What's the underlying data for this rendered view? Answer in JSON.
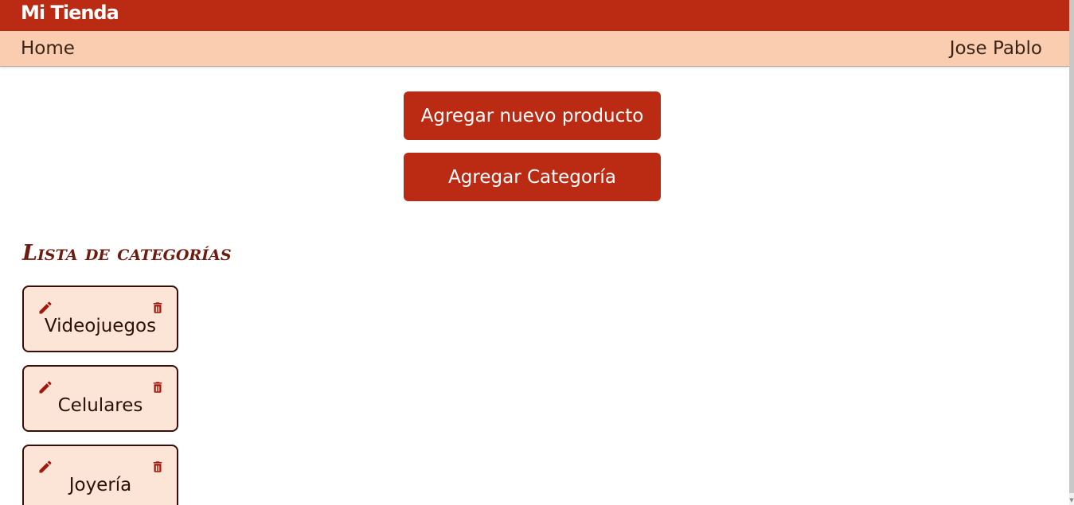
{
  "header": {
    "brand": "Mi Tienda"
  },
  "nav": {
    "home_label": "Home",
    "user_label": "Jose Pablo"
  },
  "actions": {
    "add_product_label": "Agregar nuevo producto",
    "add_category_label": "Agregar Categoría"
  },
  "categories": {
    "title": "Lista de categorías",
    "items": [
      {
        "label": "Videojuegos",
        "edit_icon": "pencil-icon",
        "delete_icon": "trash-icon"
      },
      {
        "label": "Celulares",
        "edit_icon": "pencil-icon",
        "delete_icon": "trash-icon"
      },
      {
        "label": "Joyería",
        "edit_icon": "pencil-icon",
        "delete_icon": "trash-icon"
      }
    ]
  },
  "colors": {
    "primary": "#bb2a13",
    "nav_background": "#fbcdb0",
    "card_background": "#fce5d6",
    "card_border": "#3b0d08",
    "title_color": "#6e1b10"
  }
}
